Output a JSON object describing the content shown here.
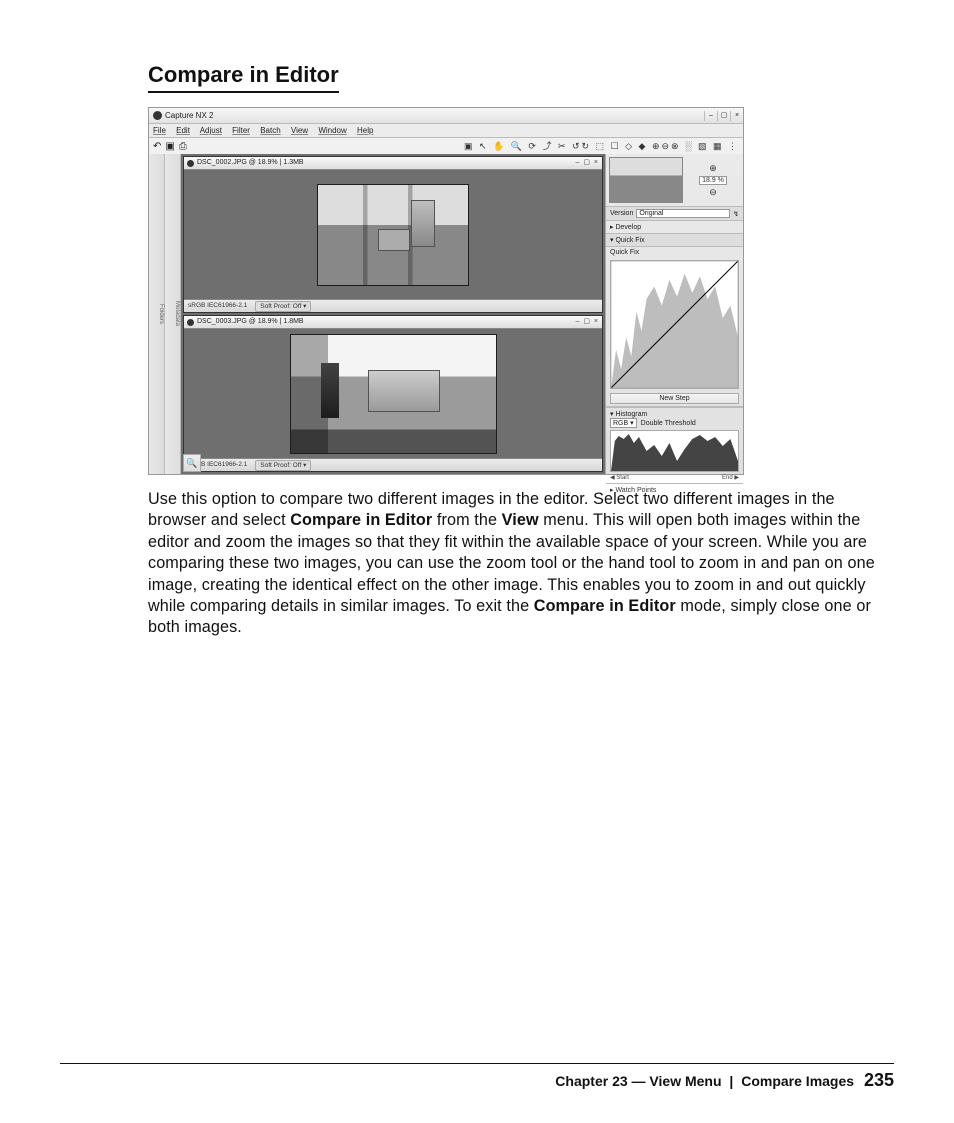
{
  "heading": "Compare in Editor",
  "screenshot": {
    "app_title": "Capture NX 2",
    "menus": [
      "File",
      "Edit",
      "Adjust",
      "Filter",
      "Batch",
      "View",
      "Window",
      "Help"
    ],
    "toolbar_right_glyphs": "▣ ↖ ✋ 🔍 ⟳ ⤴ ✂ ↺↻  ⬚ ☐ ◇ ◆  ⊕⊖⊗ ░ ▧ ▦ ⋮",
    "left_tabs": [
      "Folders",
      "Metadata"
    ],
    "image1": {
      "title": "DSC_0002.JPG @ 18.9% | 1.3MB",
      "profile": "sRGB IEC61966-2.1",
      "softproof": "Soft Proof: Off ▾"
    },
    "image2": {
      "title": "DSC_0003.JPG @ 18.9% | 1.8MB",
      "profile": "sRGB IEC61966-2.1",
      "softproof": "Soft Proof: Off ▾"
    },
    "birdseye": {
      "zoom_value": "18.9",
      "zoom_unit": "%"
    },
    "edit_panel": {
      "version_label": "Version",
      "version_value": "Original",
      "develop": "▸ Develop",
      "quickfix_hdr": "▾ Quick Fix",
      "quickfix_sub": "Quick Fix",
      "new_step": "New Step"
    },
    "histogram": {
      "title": "▾ Histogram",
      "channel": "RGB ▾",
      "thresh": "Double Threshold",
      "start": "Start",
      "end": "End"
    },
    "watch": "▸ Watch Points"
  },
  "paragraph": {
    "t1": "Use this option to compare two different images in the editor. Select two different images in the browser and select ",
    "b1": "Compare in Editor",
    "t2": " from the ",
    "b2": "View",
    "t3": " menu. This will open both images within the editor and zoom the images so that they fit within the available space of your screen. While you are comparing these two images, you can use the zoom tool or the hand tool to zoom in and pan on one image, creating the identical effect on the other image. This enables you to zoom in and out quickly while comparing details in similar images. To exit the ",
    "b3": "Compare in Editor",
    "t4": " mode, simply close one or both images."
  },
  "footer": {
    "chapter": "Chapter 23 — View Menu",
    "section": "Compare Images",
    "page": "235"
  }
}
